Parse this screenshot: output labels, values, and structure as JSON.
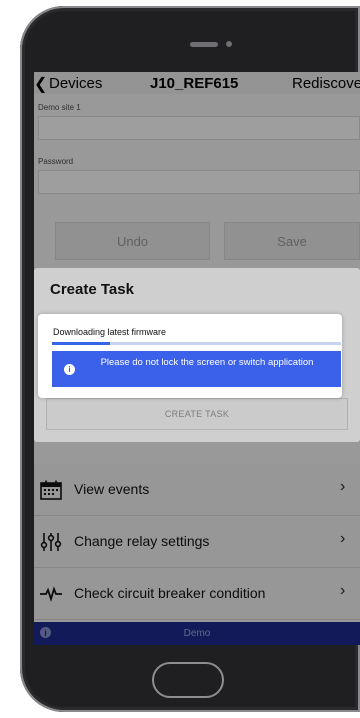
{
  "nav": {
    "back_label": "Devices",
    "title": "J10_REF615",
    "rediscover_label": "Rediscover"
  },
  "form": {
    "site_label": "Demo site 1",
    "password_label": "Password",
    "undo_label": "Undo",
    "save_label": "Save"
  },
  "modal": {
    "title": "Create Task",
    "progress_text": "Downloading latest firmware",
    "progress_fraction": 0.2,
    "notice_text": "Please do not lock the screen or switch application",
    "create_task_label": "CREATE TASK"
  },
  "menu": [
    {
      "label": "View events",
      "icon": "calendar-icon"
    },
    {
      "label": "Change relay settings",
      "icon": "sliders-icon"
    },
    {
      "label": "Check circuit breaker condition",
      "icon": "waveform-icon"
    }
  ],
  "footer": {
    "label": "Demo"
  },
  "colors": {
    "accent_blue": "#3b61ea",
    "footer_navy": "#1b2680"
  }
}
